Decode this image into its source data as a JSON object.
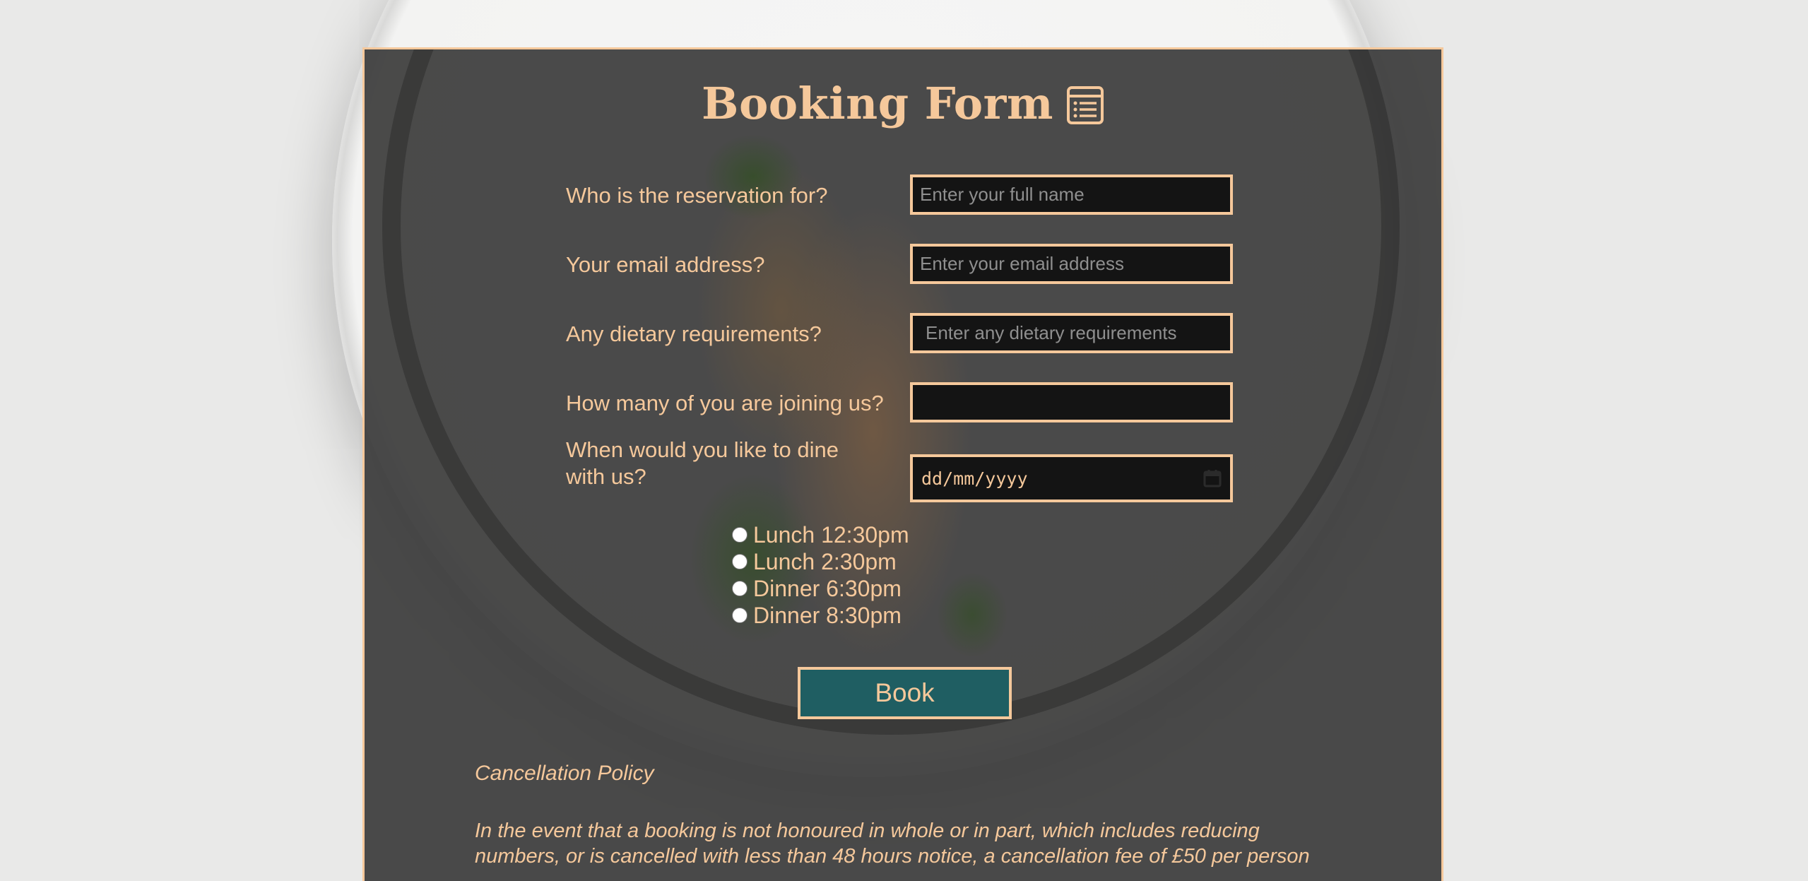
{
  "form": {
    "title": "Booking Form",
    "title_icon": "form-icon",
    "fields": [
      {
        "label": "Who is the reservation for?",
        "placeholder": "Enter your full name"
      },
      {
        "label": "Your email address?",
        "placeholder": "Enter your email address"
      },
      {
        "label": "Any dietary requirements?",
        "placeholder": "Enter any dietary requirements"
      },
      {
        "label": "How many of you are joining us?",
        "placeholder": ""
      },
      {
        "label": "When would you like to dine with us?",
        "placeholder": "dd/mm/yyyy"
      }
    ],
    "calendar_icon": "calendar-icon",
    "time_options": [
      "Lunch 12:30pm",
      "Lunch 2:30pm",
      "Dinner 6:30pm",
      "Dinner 8:30pm"
    ],
    "submit_label": "Book"
  },
  "policy": {
    "title": "Cancellation Policy",
    "text": "In the event that a booking is not honoured in whole or in part, which includes reducing numbers, or is cancelled with less than 48 hours notice, a cancellation fee of £50 per person"
  },
  "colors": {
    "accent": "#f5c89b",
    "button": "#1f5e62",
    "panel": "#3c3c3c"
  }
}
